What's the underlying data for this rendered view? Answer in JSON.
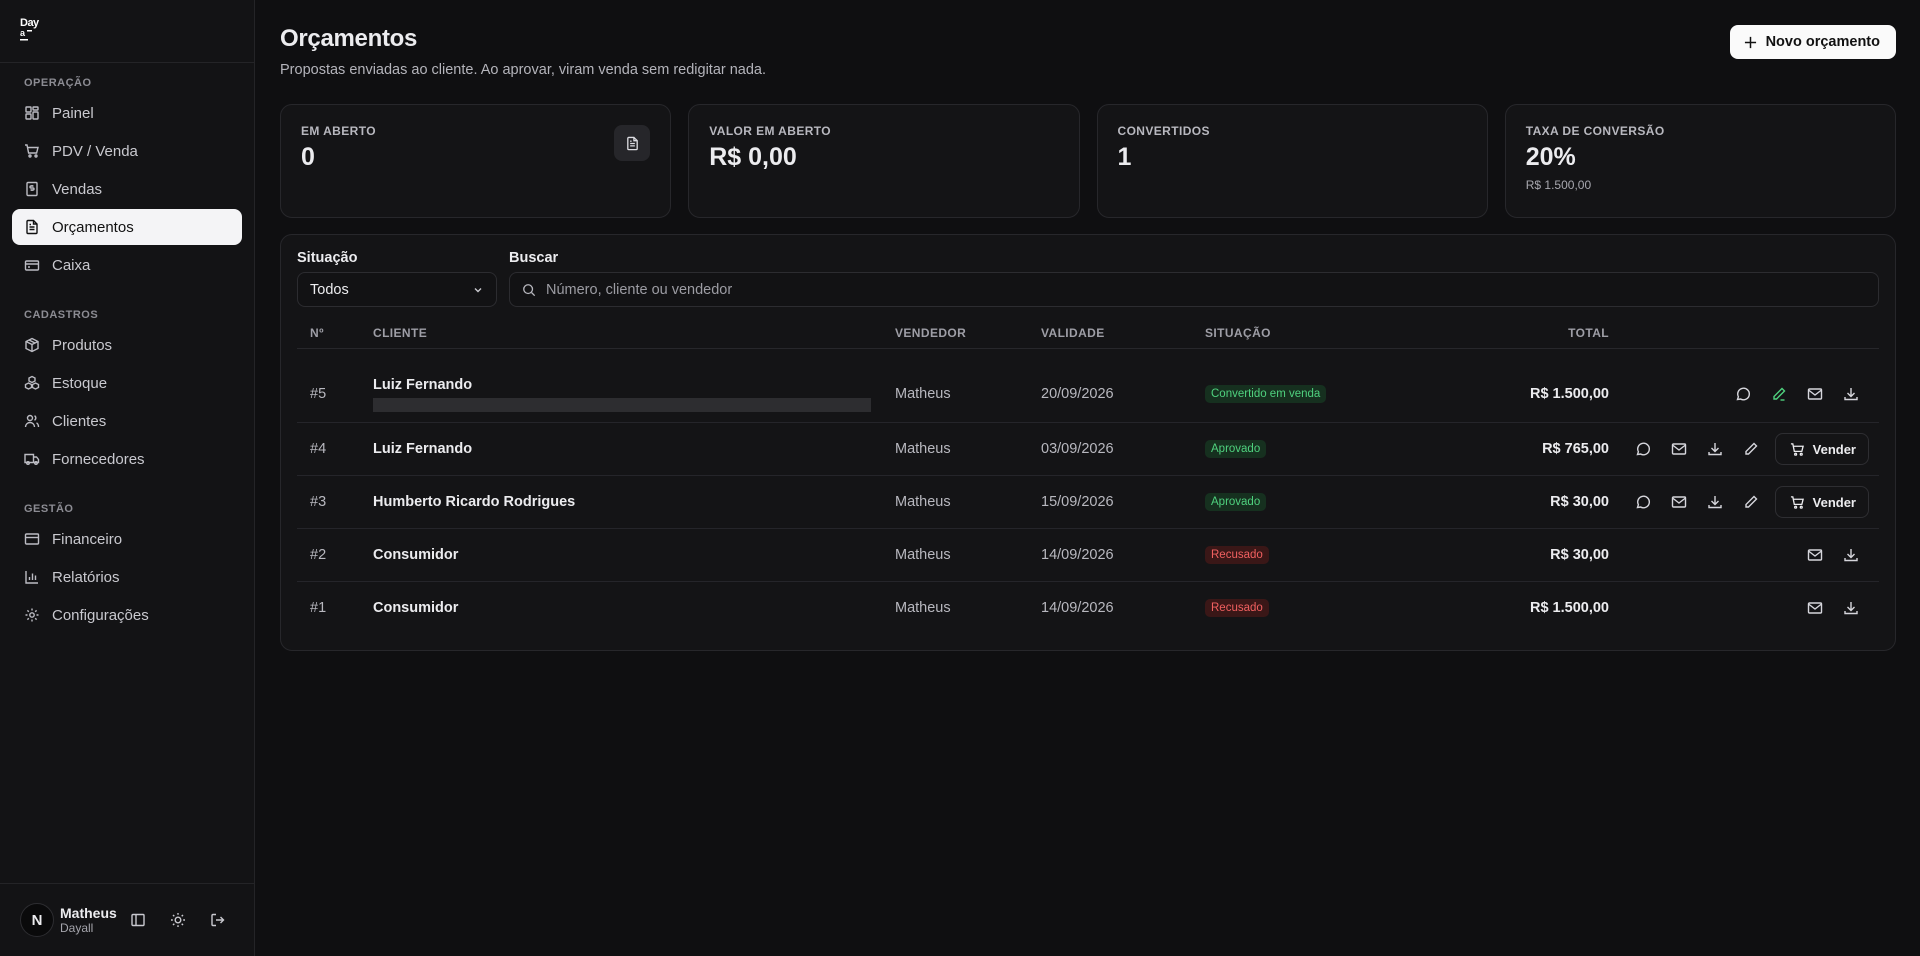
{
  "app": {
    "logo_text": "Day"
  },
  "sidebar": {
    "sections": [
      {
        "title": "OPERAÇÃO",
        "items": [
          "Painel",
          "PDV / Venda",
          "Vendas",
          "Orçamentos",
          "Caixa"
        ]
      },
      {
        "title": "CADASTROS",
        "items": [
          "Produtos",
          "Estoque",
          "Clientes",
          "Fornecedores"
        ]
      },
      {
        "title": "GESTÃO",
        "items": [
          "Financeiro",
          "Relatórios",
          "Configurações"
        ]
      }
    ],
    "active_item": "Orçamentos",
    "user": {
      "initial": "N",
      "name": "Matheus",
      "org": "Dayall"
    }
  },
  "header": {
    "title": "Orçamentos",
    "subtitle": "Propostas enviadas ao cliente. Ao aprovar, viram venda sem redigitar nada.",
    "new_button": "Novo orçamento"
  },
  "stats": [
    {
      "label": "EM ABERTO",
      "value": "0",
      "sub": ""
    },
    {
      "label": "VALOR EM ABERTO",
      "value": "R$ 0,00",
      "sub": ""
    },
    {
      "label": "CONVERTIDOS",
      "value": "1",
      "sub": ""
    },
    {
      "label": "TAXA DE CONVERSÃO",
      "value": "20%",
      "sub": "R$ 1.500,00"
    }
  ],
  "filters": {
    "status_label": "Situação",
    "status_value": "Todos",
    "search_label": "Buscar",
    "search_placeholder": "Número, cliente ou vendedor"
  },
  "table": {
    "columns": [
      "Nº",
      "CLIENTE",
      "VENDEDOR",
      "VALIDADE",
      "SITUAÇÃO",
      "TOTAL"
    ],
    "rows": [
      {
        "num": "#5",
        "client": "Luiz Fernando",
        "seller": "Matheus",
        "validity": "20/09/2026",
        "status": "Convertido em venda",
        "status_color": "#4fd17e",
        "total": "R$ 1.500,00"
      },
      {
        "num": "#4",
        "client": "Luiz Fernando",
        "seller": "Matheus",
        "validity": "03/09/2026",
        "status": "Aprovado",
        "status_color": "#4fd17e",
        "total": "R$ 765,00"
      },
      {
        "num": "#3",
        "client": "Humberto Ricardo Rodrigues",
        "seller": "Matheus",
        "validity": "15/09/2026",
        "status": "Aprovado",
        "status_color": "#4fd17e",
        "total": "R$ 30,00"
      },
      {
        "num": "#2",
        "client": "Consumidor",
        "seller": "Matheus",
        "validity": "14/09/2026",
        "status": "Recusado",
        "status_color": "#f06060",
        "total": "R$ 30,00"
      },
      {
        "num": "#1",
        "client": "Consumidor",
        "seller": "Matheus",
        "validity": "14/09/2026",
        "status": "Recusado",
        "status_color": "#f06060",
        "total": "R$ 1.500,00"
      }
    ],
    "sell_label": "Vender"
  }
}
